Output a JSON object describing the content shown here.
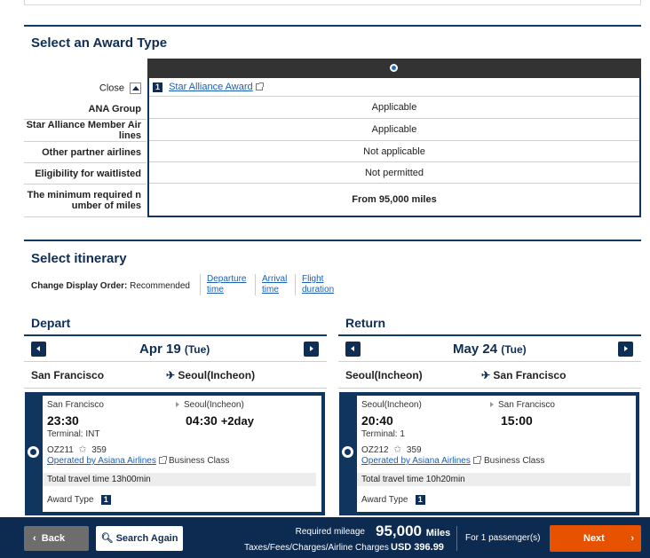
{
  "award_section": {
    "title": "Select an Award Type",
    "close_label": "Close",
    "award_number": "1",
    "award_name": "Star Alliance Award",
    "rows": [
      {
        "label": "ANA Group",
        "value": "Applicable"
      },
      {
        "label": "Star Alliance Member Air lines",
        "value": "Applicable"
      },
      {
        "label": "Other partner airlines",
        "value": "Not applicable"
      },
      {
        "label": "Eligibility for waitlisted",
        "value": "Not permitted"
      },
      {
        "label": "The minimum required n umber of miles",
        "value": "From 95,000 miles"
      }
    ]
  },
  "itinerary": {
    "title": "Select itinerary",
    "sort_label": "Change Display Order:",
    "sort_current": "Recommended",
    "sort_options": [
      {
        "line1": "Departure",
        "line2": "time"
      },
      {
        "line1": "Arrival",
        "line2": "time"
      },
      {
        "line1": "Flight",
        "line2": "duration"
      }
    ]
  },
  "depart": {
    "title": "Depart",
    "date": "Apr 19",
    "dow": "(Tue)",
    "from": "San Francisco",
    "to": "Seoul(Incheon)",
    "card": {
      "from_city": "San Francisco",
      "to_city": "Seoul(Incheon)",
      "dep_time": "23:30",
      "arr_time": "04:30",
      "arr_plus": "+2day",
      "terminal": "Terminal: INT",
      "flight_no": "OZ211",
      "aircraft": "359",
      "operated_by": "Operated by Asiana Airlines",
      "cabin": "Business Class",
      "travel_time": "Total travel time 13h00min",
      "award_type_label": "Award Type",
      "award_type_num": "1"
    }
  },
  "return": {
    "title": "Return",
    "date": "May 24",
    "dow": "(Tue)",
    "from": "Seoul(Incheon)",
    "to": "San Francisco",
    "card": {
      "from_city": "Seoul(Incheon)",
      "to_city": "San Francisco",
      "dep_time": "20:40",
      "arr_time": "15:00",
      "terminal": "Terminal: 1",
      "flight_no": "OZ212",
      "aircraft": "359",
      "operated_by": "Operated by Asiana Airlines",
      "cabin": "Business Class",
      "travel_time": "Total travel time 10h20min",
      "award_type_label": "Award Type",
      "award_type_num": "1"
    }
  },
  "footer": {
    "back": "Back",
    "search_again": "Search Again",
    "required_label": "Required mileage",
    "required_value": "95,000",
    "required_unit": "Miles",
    "tax_label": "Taxes/Fees/Charges/Airline Charges",
    "tax_value": "USD  396.99",
    "passengers": "For 1 passenger(s)",
    "next": "Next"
  },
  "colors": {
    "navy": "#0f2e55",
    "next_orange": "#e65200",
    "footer_bg": "#0d2a50"
  }
}
